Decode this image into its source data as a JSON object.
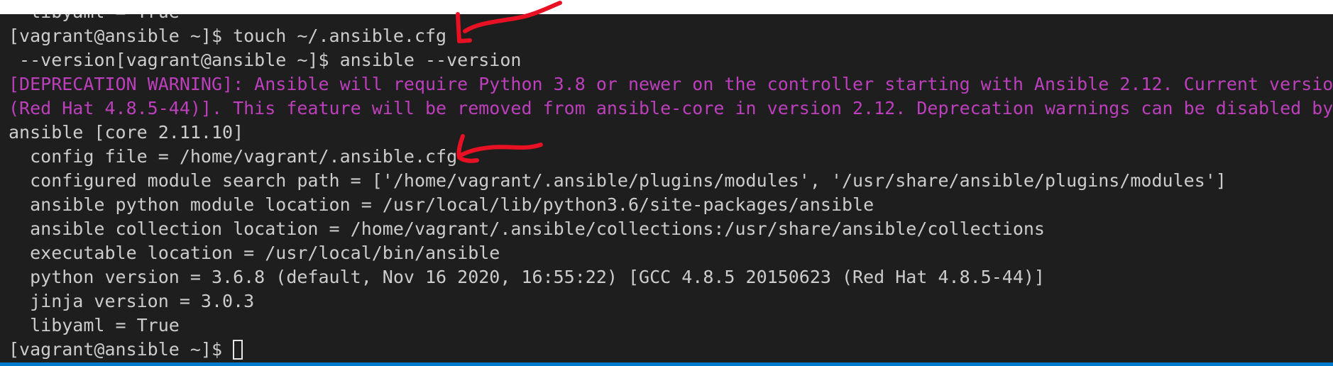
{
  "terminal": {
    "lines": [
      "  libyaml = True",
      "[vagrant@ansible ~]$ touch ~/.ansible.cfg",
      " --version[vagrant@ansible ~]$ ansible --version",
      "[DEPRECATION WARNING]: Ansible will require Python 3.8 or newer on the controller starting with Ansible 2.12. Current version",
      "(Red Hat 4.8.5-44)]. This feature will be removed from ansible-core in version 2.12. Deprecation warnings can be disabled by",
      "ansible [core 2.11.10]",
      "  config file = /home/vagrant/.ansible.cfg",
      "  configured module search path = ['/home/vagrant/.ansible/plugins/modules', '/usr/share/ansible/plugins/modules']",
      "  ansible python module location = /usr/local/lib/python3.6/site-packages/ansible",
      "  ansible collection location = /home/vagrant/.ansible/collections:/usr/share/ansible/collections",
      "  executable location = /usr/local/bin/ansible",
      "  python version = 3.6.8 (default, Nov 16 2020, 16:55:22) [GCC 4.8.5 20150623 (Red Hat 4.8.5-44)]",
      "  jinja version = 3.0.3",
      "  libyaml = True"
    ],
    "prompt": "[vagrant@ansible ~]$ "
  },
  "colors": {
    "background": "#1e1e1e",
    "text": "#cccccc",
    "warning": "#bc3fbc",
    "annotation": "#e81123",
    "status_bar": "#007acc"
  },
  "annotations": {
    "icon": "red-arrow-icon"
  }
}
